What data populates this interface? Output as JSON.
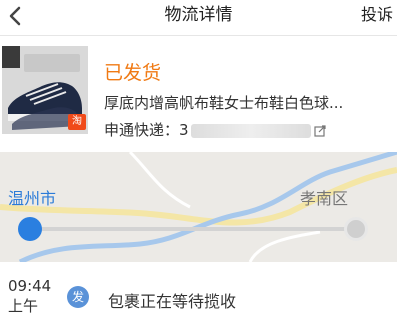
{
  "header": {
    "title": "物流详情",
    "report_label": "投诉"
  },
  "order": {
    "status": "已发货",
    "product_name": "厚底内增高帆布鞋女士布鞋白色球...",
    "courier_label": "申通快递：3",
    "thumbnail_badge": "淘"
  },
  "route": {
    "from_city": "温州市",
    "to_city": "孝南区",
    "progress_fraction": 0.0
  },
  "events": [
    {
      "time_line1": "09:44",
      "time_line2": "上午",
      "icon_label": "发",
      "text": "包裹正在等待揽收"
    }
  ],
  "colors": {
    "accent_orange": "#f07a14",
    "accent_blue": "#2a7fe0"
  }
}
